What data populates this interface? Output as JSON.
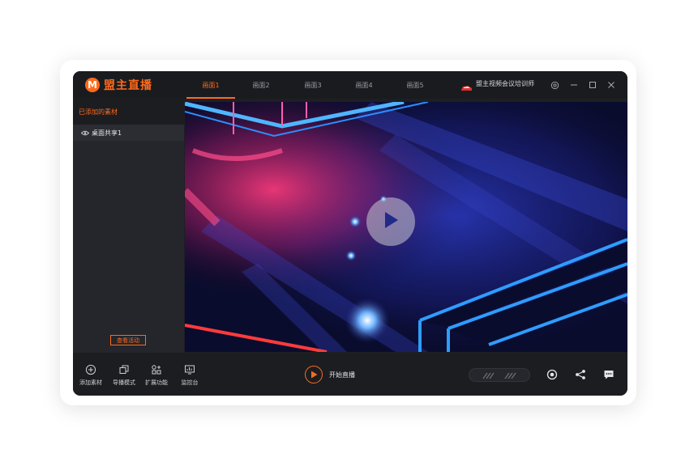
{
  "app": {
    "logo_text": "盟主直播",
    "logo_letter": "M"
  },
  "tabs": [
    {
      "label": "画面1",
      "active": true
    },
    {
      "label": "画面2",
      "active": false
    },
    {
      "label": "画面3",
      "active": false
    },
    {
      "label": "画面4",
      "active": false
    },
    {
      "label": "画面5",
      "active": false
    }
  ],
  "brand": {
    "label": "盟主视频会议培训师"
  },
  "sidebar": {
    "header": "已添加的素材",
    "items": [
      {
        "label": "桌面共享1"
      }
    ],
    "view_activity_button": "查看活动"
  },
  "toolbar": {
    "add_material": "添加素材",
    "director_mode": "导播模式",
    "extensions": "扩展功能",
    "monitor": "监控台",
    "start_live": "开始直播"
  },
  "colors": {
    "accent": "#ff6a1a",
    "background": "#1e1f23",
    "panel": "#25262b"
  }
}
